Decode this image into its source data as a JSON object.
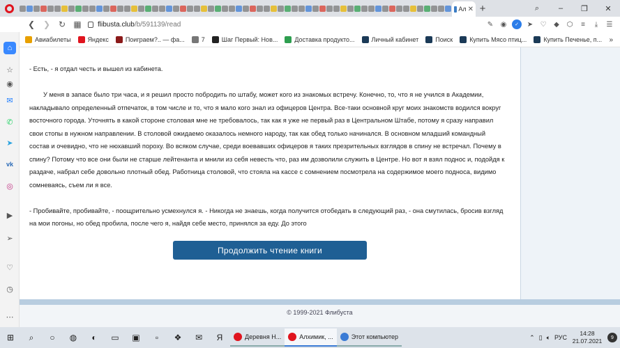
{
  "browser": {
    "active_tab_title": "Ал",
    "url_host": "flibusta.club",
    "url_path": "/b/591139/read",
    "window_controls": [
      "–",
      "❐",
      "✕"
    ]
  },
  "bookmarks": [
    {
      "label": "Авиабилеты",
      "icon_color": "#e8a000"
    },
    {
      "label": "Яндекс",
      "icon_color": "#e0141e"
    },
    {
      "label": "Поиграем?.. — фа...",
      "icon_color": "#8b1a1a"
    },
    {
      "label": "7",
      "icon_color": "#777777"
    },
    {
      "label": "Шаг Первый: Нов...",
      "icon_color": "#222222"
    },
    {
      "label": "Доставка продукто...",
      "icon_color": "#2e9e4f"
    },
    {
      "label": "Личный кабинет",
      "icon_color": "#1b3a57"
    },
    {
      "label": "Поиск",
      "icon_color": "#1b3a57"
    },
    {
      "label": "Купить Мясо птиц...",
      "icon_color": "#1b3a57"
    },
    {
      "label": "Купить Печенье, п...",
      "icon_color": "#1b3a57"
    }
  ],
  "bookmarks_more": "»",
  "reader": {
    "paragraphs": [
      "- Есть, - я отдал честь и вышел из кабинета.",
      "У меня в запасе было три часа, и я решил просто побродить по штабу, может кого из знакомых встречу. Конечно, то, что я не учился в Академии, накладывало определенный отпечаток, в том числе и то, что я мало кого знал из офицеров Центра. Все-таки основной круг моих знакомств водился вокруг восточного города. Уточнять в какой стороне столовая мне не требовалось, так как я уже не первый раз в Центральном Штабе, потому я сразу направил свои стопы в нужном направлении. В столовой ожидаемо оказалось немного народу, так как обед только начинался. В основном младший командный состав и очевидно, что не нюхавший пороху. Во всяком случае, среди воевавших офицеров я таких презрительных взглядов в спину не встречал. Почему в спину? Потому что все они были не старше лейтенанта и мнили из себя невесть что, раз им дозволили служить в Центре. Но вот я взял поднос и, подойдя к раздаче, набрал себе довольно плотный обед. Работница столовой, что стояла на кассе с сомнением посмотрела на содержимое моего подноса, видимо сомневаясь, съем ли я все.",
      "- Пробивайте, пробивайте, - поощрительно усмехнулся я. - Никогда не знаешь, когда получится отобедать в следующий раз, - она смутилась, бросив взгляд на мои погоны, но обед пробила, после чего я, найдя себе место, принялся за еду. До этого"
    ],
    "continue_button": "Продолжить чтение книги",
    "footer": "© 1999-2021 Флибуста"
  },
  "taskbar": {
    "tasks": [
      {
        "label": "Деревня Н...",
        "icon_color": "#e0141e"
      },
      {
        "label": "Алхимик, ...",
        "icon_color": "#e0141e"
      },
      {
        "label": "Этот компьютер",
        "icon_color": "#3a7bd5"
      }
    ],
    "language": "РУС",
    "time": "14:28",
    "date": "21.07.2021",
    "notifications": "9"
  }
}
